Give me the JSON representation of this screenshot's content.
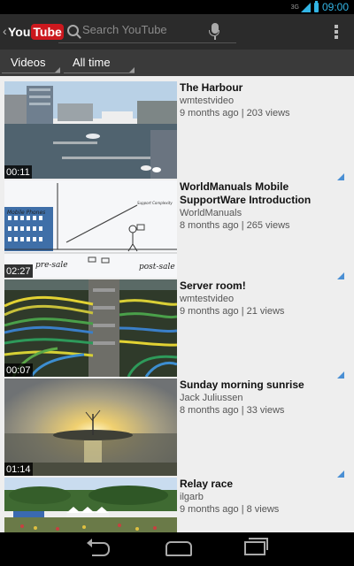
{
  "status": {
    "network": "3G",
    "time": "09:00"
  },
  "app": {
    "logo_you": "You",
    "logo_tube": "Tube"
  },
  "search": {
    "placeholder": "Search YouTube"
  },
  "filters": {
    "category": "Videos",
    "time": "All time"
  },
  "videos": [
    {
      "title": "The Harbour",
      "channel": "wmtestvideo",
      "stats": "9 months ago | 203 views",
      "duration": "00:11"
    },
    {
      "title": "WorldManuals Mobile SupportWare Introduction",
      "channel": "WorldManuals",
      "stats": "8 months ago | 265 views",
      "duration": "02:27"
    },
    {
      "title": "Server room!",
      "channel": "wmtestvideo",
      "stats": "9 months ago | 21 views",
      "duration": "00:07"
    },
    {
      "title": "Sunday morning sunrise",
      "channel": "Jack Juliussen",
      "stats": "8 months ago | 33 views",
      "duration": "01:14"
    },
    {
      "title": "Relay race",
      "channel": "ilgarb",
      "stats": "9 months ago | 8 views",
      "duration": ""
    }
  ],
  "thumb_labels": {
    "phones": "Mobile Phones",
    "presale": "pre-sale",
    "postsale": "post-sale",
    "support": "Support Complexity"
  },
  "colors": {
    "accent": "#33b5e5",
    "brand_red": "#cc181e",
    "list_bg": "#eeeeee",
    "menu_triangle": "#4a8fd4"
  }
}
